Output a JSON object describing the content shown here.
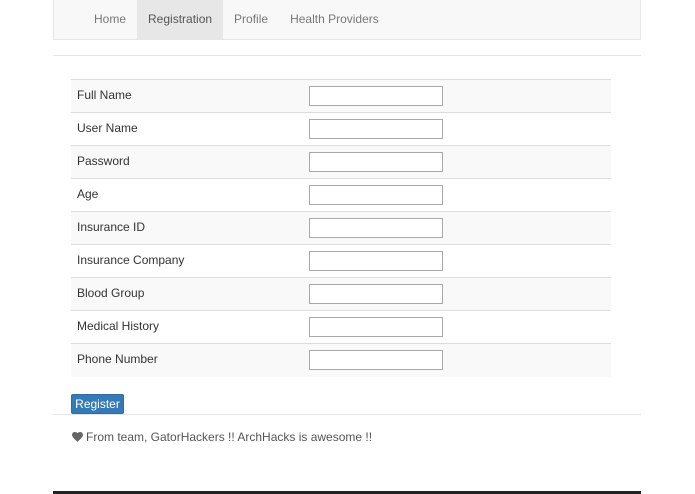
{
  "nav": {
    "items": [
      {
        "label": "Home",
        "active": false
      },
      {
        "label": "Registration",
        "active": true
      },
      {
        "label": "Profile",
        "active": false
      },
      {
        "label": "Health Providers",
        "active": false
      }
    ]
  },
  "form": {
    "fields": [
      {
        "label": "Full Name",
        "value": ""
      },
      {
        "label": "User Name",
        "value": ""
      },
      {
        "label": "Password",
        "value": ""
      },
      {
        "label": "Age",
        "value": ""
      },
      {
        "label": "Insurance ID",
        "value": ""
      },
      {
        "label": "Insurance Company",
        "value": ""
      },
      {
        "label": "Blood Group",
        "value": ""
      },
      {
        "label": "Medical History",
        "value": ""
      },
      {
        "label": "Phone Number",
        "value": ""
      }
    ],
    "submit_label": "Register"
  },
  "footer": {
    "text": "From team, GatorHackers !! ArchHacks is awesome !!",
    "icon": "heart-icon"
  },
  "colors": {
    "primary_button": "#337ab7",
    "navbar_bg": "#f8f8f8",
    "nav_active_bg": "#e7e7e7"
  }
}
